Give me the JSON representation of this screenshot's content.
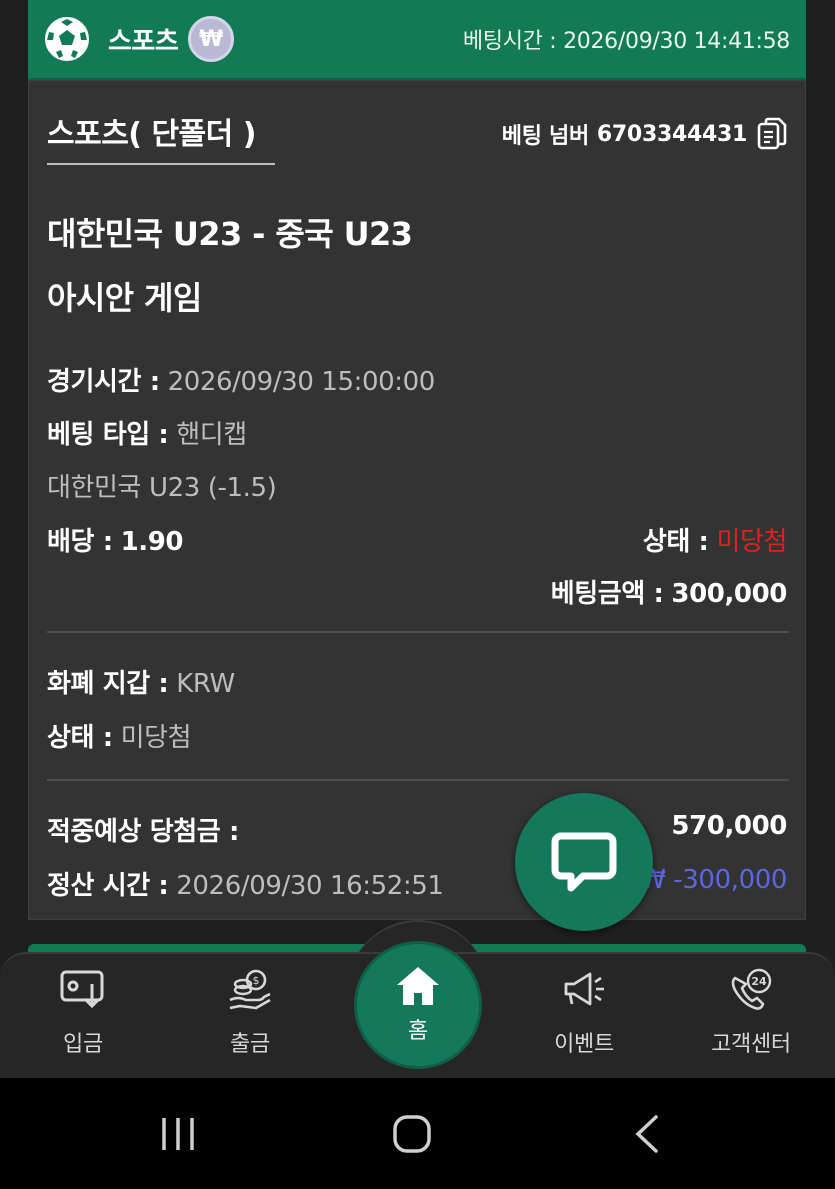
{
  "header": {
    "title": "스포츠",
    "currency_symbol": "₩",
    "bet_time_label": "베팅시간 :",
    "bet_time_value": "2026/09/30 14:41:58"
  },
  "card": {
    "bet_type_title": "스포츠( 단폴더 )",
    "bet_number_label": "베팅 넘버",
    "bet_number_value": "6703344431",
    "match_title": "대한민국 U23 - 중국 U23",
    "league": "아시안 게임",
    "match_time_label": "경기시간 :",
    "match_time_value": "2026/09/30 15:00:00",
    "bet_kind_label": "베팅 타입 :",
    "bet_kind_value": "핸디캡",
    "selection": "대한민국 U23 (-1.5)",
    "odds_label": "배당 :",
    "odds_value": "1.90",
    "status_label": "상태 :",
    "status_value": "미당첨",
    "stake_label": "베팅금액 :",
    "stake_value": "300,000",
    "wallet_label": "화폐 지갑 :",
    "wallet_value": "KRW",
    "status2_label": "상태 :",
    "status2_value": "미당첨",
    "expected_win_label": "적중예상 당첨금 :",
    "expected_win_value": "570,000",
    "settle_time_label": "정산 시간 :",
    "settle_time_value": "2026/09/30 16:52:51",
    "settle_amount": "₩ -300,000"
  },
  "nav": {
    "deposit": "입금",
    "withdraw": "출금",
    "home": "홈",
    "event": "이벤트",
    "support": "고객센터",
    "support_badge": "24"
  },
  "colors": {
    "brand_green": "#127a55",
    "loss_red": "#e0201f",
    "amount_blue": "#5a66e6"
  }
}
